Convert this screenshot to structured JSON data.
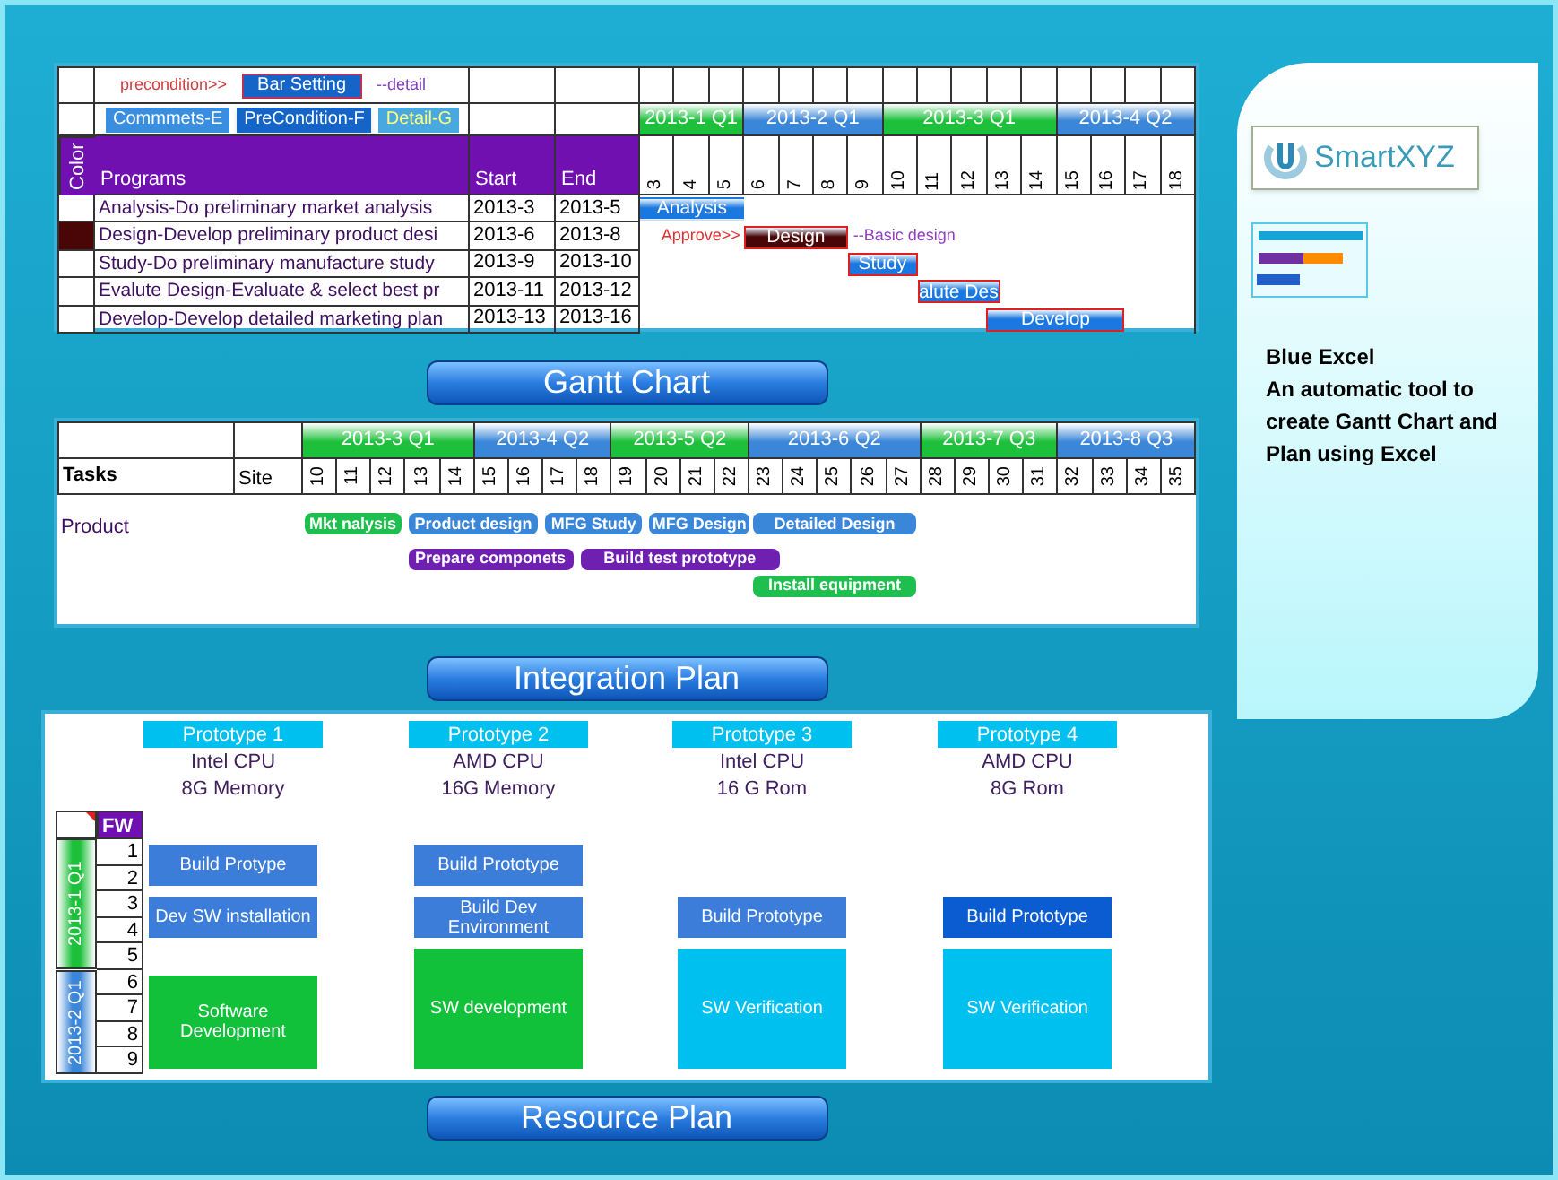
{
  "gantt": {
    "toolbar": {
      "precondition_label": "precondition>>",
      "bar_setting_button": "Bar Setting",
      "detail_label": "--detail",
      "buttons": [
        {
          "label": "Commmets-E",
          "kind": "comment"
        },
        {
          "label": "PreCondition-F",
          "kind": "precondition"
        },
        {
          "label": "Detail-G",
          "kind": "detail"
        }
      ]
    },
    "columns": {
      "color_column": "Color",
      "programs": "Programs",
      "start": "Start",
      "end": "End"
    },
    "quarters": [
      {
        "label": "2013-1 Q1",
        "color": "#1cc03a",
        "weeks": [
          "3",
          "4",
          "5"
        ]
      },
      {
        "label": "2013-2 Q1",
        "color": "#3a86d8",
        "weeks": [
          "6",
          "7",
          "8",
          "9"
        ]
      },
      {
        "label": "2013-3 Q1",
        "color": "#1cc03a",
        "weeks": [
          "10",
          "11",
          "12",
          "13",
          "14"
        ]
      },
      {
        "label": "2013-4 Q2",
        "color": "#3a86d8",
        "weeks": [
          "15",
          "16",
          "17",
          "18"
        ]
      }
    ],
    "rows": [
      {
        "program": "Analysis-Do preliminary market analysis",
        "start": "2013-3",
        "end": "2013-5",
        "bar": "Analysis",
        "bordered": false
      },
      {
        "program": "Design-Develop preliminary product desi",
        "start": "2013-6",
        "end": "2013-8",
        "bar": "Design",
        "bordered": true,
        "color": "#4a0606",
        "before": "Approve>>",
        "after": "--Basic design"
      },
      {
        "program": "Study-Do preliminary manufacture study",
        "start": "2013-9",
        "end": "2013-10",
        "bar": "Study",
        "bordered": true
      },
      {
        "program": "Evalute Design-Evaluate & select best pr",
        "start": "2013-11",
        "end": "2013-12",
        "bar": "alute Des",
        "bordered": true
      },
      {
        "program": "Develop-Develop detailed marketing plan",
        "start": "2013-13",
        "end": "2013-16",
        "bar": "Develop",
        "bordered": true
      }
    ]
  },
  "gantt_title": "Gantt Chart",
  "integration": {
    "tasks_label": "Tasks",
    "site_label": "Site",
    "quarters": [
      {
        "label": "2013-3 Q1",
        "color": "#1cc03a",
        "weeks": [
          "10",
          "11",
          "12",
          "13",
          "14"
        ]
      },
      {
        "label": "2013-4 Q2",
        "color": "#3a86d8",
        "weeks": [
          "15",
          "16",
          "17",
          "18"
        ]
      },
      {
        "label": "2013-5 Q2",
        "color": "#1cc03a",
        "weeks": [
          "19",
          "20",
          "21",
          "22"
        ]
      },
      {
        "label": "2013-6 Q2",
        "color": "#3a86d8",
        "weeks": [
          "23",
          "24",
          "25",
          "26",
          "27"
        ]
      },
      {
        "label": "2013-7 Q3",
        "color": "#1cc03a",
        "weeks": [
          "28",
          "29",
          "30",
          "31"
        ]
      },
      {
        "label": "2013-8 Q3",
        "color": "#3a86d8",
        "weeks": [
          "32",
          "33",
          "34",
          "35"
        ]
      }
    ],
    "groups": [
      {
        "name": "Product",
        "lanes": [
          {
            "bars": [
              {
                "label": "Mkt nalysis",
                "color": "#1fbf4f"
              },
              {
                "label": "Product  design",
                "color": "#3a86d8"
              },
              {
                "label": "MFG Study",
                "color": "#3a86d8"
              },
              {
                "label": "MFG Design",
                "color": "#3a86d8"
              },
              {
                "label": "Detailed Design",
                "color": "#3a86d8"
              }
            ]
          },
          {
            "bars": [
              {
                "label": "Prepare componets",
                "color": "#7020b0"
              },
              {
                "label": "Build test prototype",
                "color": "#7020b0"
              }
            ]
          },
          {
            "bars": [
              {
                "label": "Install equipment",
                "color": "#1fbf4f"
              }
            ]
          }
        ]
      }
    ]
  },
  "integration_title": "Integration Plan",
  "resource": {
    "fw_label": "FW",
    "quarters": [
      {
        "label": "2013-1 Q1",
        "color": "#1cc03a",
        "rows": [
          "1",
          "2",
          "3",
          "4",
          "5"
        ]
      },
      {
        "label": "2013-2 Q1",
        "color": "#3a86d8",
        "rows": [
          "6",
          "7",
          "8",
          "9"
        ]
      }
    ],
    "prototypes": [
      {
        "title": "Prototype 1",
        "cpu": "Intel CPU",
        "memory": "8G Memory",
        "tasks": [
          {
            "label": "Build Protype",
            "color": "#3b7dd8"
          },
          {
            "label": "Dev SW installation",
            "color": "#3b7dd8"
          },
          {
            "label": "Software Development",
            "color": "#12c13a"
          }
        ]
      },
      {
        "title": "Prototype 2",
        "cpu": "AMD CPU",
        "memory": "16G Memory",
        "tasks": [
          {
            "label": "Build Prototype",
            "color": "#3b7dd8"
          },
          {
            "label": "Build Dev Environment",
            "color": "#3b7dd8"
          },
          {
            "label": "SW development",
            "color": "#12c13a"
          }
        ]
      },
      {
        "title": "Prototype 3",
        "cpu": "Intel CPU",
        "memory": "16 G Rom",
        "tasks": [
          {
            "label": "Build Prototype",
            "color": "#3b7dd8"
          },
          {
            "label": "SW Verification",
            "color": "#00c0f0"
          }
        ]
      },
      {
        "title": "Prototype 4",
        "cpu": "AMD CPU",
        "memory": "8G Rom",
        "tasks": [
          {
            "label": "Build Prototype",
            "color": "#0a5cd0"
          },
          {
            "label": "SW Verification",
            "color": "#00c0f0"
          }
        ]
      }
    ]
  },
  "resource_title": "Resource Plan",
  "sidebar": {
    "logo": "SmartXYZ",
    "title": "Blue Excel",
    "description": "An automatic tool to create Gantt Chart and Plan using Excel"
  }
}
